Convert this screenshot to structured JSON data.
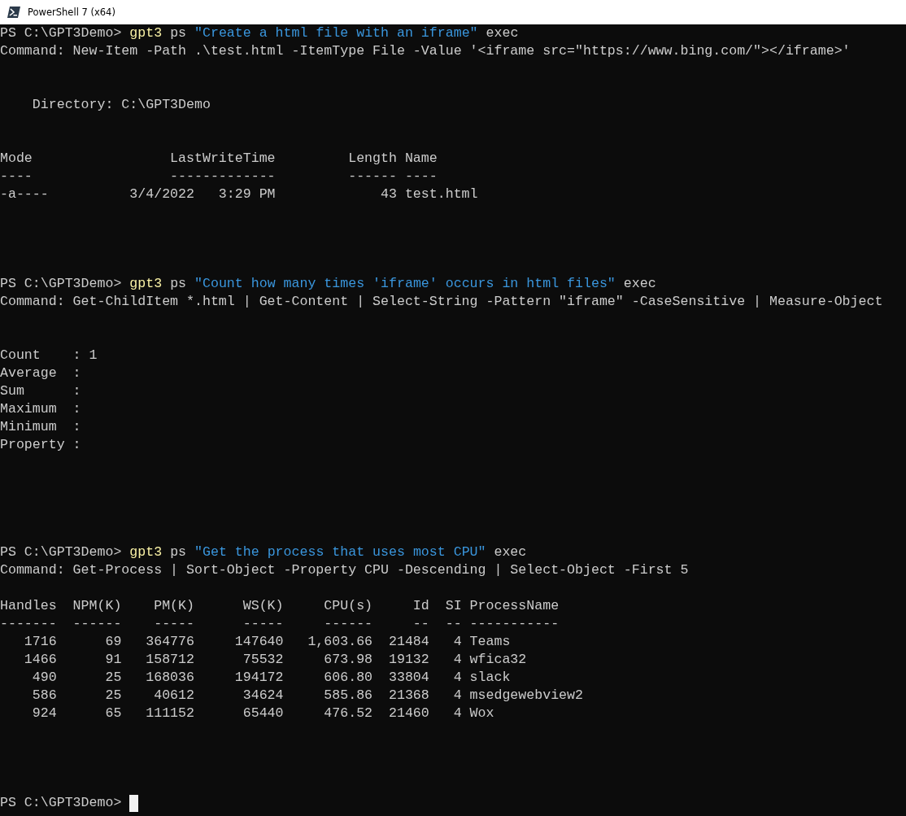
{
  "window": {
    "title": "PowerShell 7 (x64)"
  },
  "terminal": {
    "lines": [
      {
        "kind": "text",
        "segments": [
          {
            "kind": "plain",
            "text": "PS C:\\GPT3Demo> "
          },
          {
            "kind": "command",
            "text": "gpt3"
          },
          {
            "kind": "plain",
            "text": " ps "
          },
          {
            "kind": "string",
            "text": "\"Create a html file with an iframe\""
          },
          {
            "kind": "plain",
            "text": " exec"
          }
        ]
      },
      {
        "kind": "text",
        "segments": [
          {
            "kind": "plain",
            "text": "Command: New-Item -Path .\\test.html -ItemType File -Value '<iframe src=\"https://www.bing.com/\"></iframe>'"
          }
        ]
      },
      {
        "kind": "blank"
      },
      {
        "kind": "blank"
      },
      {
        "kind": "text",
        "segments": [
          {
            "kind": "plain",
            "text": "    Directory: C:\\GPT3Demo"
          }
        ]
      },
      {
        "kind": "blank"
      },
      {
        "kind": "blank"
      },
      {
        "kind": "text",
        "segments": [
          {
            "kind": "plain",
            "text": "Mode                 LastWriteTime         Length Name"
          }
        ]
      },
      {
        "kind": "text",
        "segments": [
          {
            "kind": "plain",
            "text": "----                 -------------         ------ ----"
          }
        ]
      },
      {
        "kind": "text",
        "segments": [
          {
            "kind": "plain",
            "text": "-a----          3/4/2022   3:29 PM             43 test.html"
          }
        ]
      },
      {
        "kind": "blank"
      },
      {
        "kind": "blank"
      },
      {
        "kind": "blank"
      },
      {
        "kind": "blank"
      },
      {
        "kind": "text",
        "segments": [
          {
            "kind": "plain",
            "text": "PS C:\\GPT3Demo> "
          },
          {
            "kind": "command",
            "text": "gpt3"
          },
          {
            "kind": "plain",
            "text": " ps "
          },
          {
            "kind": "string",
            "text": "\"Count how many times 'iframe' occurs in html files\""
          },
          {
            "kind": "plain",
            "text": " exec"
          }
        ]
      },
      {
        "kind": "text",
        "segments": [
          {
            "kind": "plain",
            "text": "Command: Get-ChildItem *.html | Get-Content | Select-String -Pattern \"iframe\" -CaseSensitive | Measure-Object"
          }
        ]
      },
      {
        "kind": "blank"
      },
      {
        "kind": "blank"
      },
      {
        "kind": "text",
        "segments": [
          {
            "kind": "plain",
            "text": "Count    : 1"
          }
        ]
      },
      {
        "kind": "text",
        "segments": [
          {
            "kind": "plain",
            "text": "Average  :"
          }
        ]
      },
      {
        "kind": "text",
        "segments": [
          {
            "kind": "plain",
            "text": "Sum      :"
          }
        ]
      },
      {
        "kind": "text",
        "segments": [
          {
            "kind": "plain",
            "text": "Maximum  :"
          }
        ]
      },
      {
        "kind": "text",
        "segments": [
          {
            "kind": "plain",
            "text": "Minimum  :"
          }
        ]
      },
      {
        "kind": "text",
        "segments": [
          {
            "kind": "plain",
            "text": "Property :"
          }
        ]
      },
      {
        "kind": "blank"
      },
      {
        "kind": "blank"
      },
      {
        "kind": "blank"
      },
      {
        "kind": "blank"
      },
      {
        "kind": "blank"
      },
      {
        "kind": "text",
        "segments": [
          {
            "kind": "plain",
            "text": "PS C:\\GPT3Demo> "
          },
          {
            "kind": "command",
            "text": "gpt3"
          },
          {
            "kind": "plain",
            "text": " ps "
          },
          {
            "kind": "string",
            "text": "\"Get the process that uses most CPU\""
          },
          {
            "kind": "plain",
            "text": " exec"
          }
        ]
      },
      {
        "kind": "text",
        "segments": [
          {
            "kind": "plain",
            "text": "Command: Get-Process | Sort-Object -Property CPU -Descending | Select-Object -First 5"
          }
        ]
      },
      {
        "kind": "blank"
      },
      {
        "kind": "text",
        "segments": [
          {
            "kind": "plain",
            "text": "Handles  NPM(K)    PM(K)      WS(K)     CPU(s)     Id  SI ProcessName"
          }
        ]
      },
      {
        "kind": "text",
        "segments": [
          {
            "kind": "plain",
            "text": "-------  ------    -----      -----     ------     --  -- -----------"
          }
        ]
      },
      {
        "kind": "text",
        "segments": [
          {
            "kind": "plain",
            "text": "   1716      69   364776     147640   1,603.66  21484   4 Teams"
          }
        ]
      },
      {
        "kind": "text",
        "segments": [
          {
            "kind": "plain",
            "text": "   1466      91   158712      75532     673.98  19132   4 wfica32"
          }
        ]
      },
      {
        "kind": "text",
        "segments": [
          {
            "kind": "plain",
            "text": "    490      25   168036     194172     606.80  33804   4 slack"
          }
        ]
      },
      {
        "kind": "text",
        "segments": [
          {
            "kind": "plain",
            "text": "    586      25    40612      34624     585.86  21368   4 msedgewebview2"
          }
        ]
      },
      {
        "kind": "text",
        "segments": [
          {
            "kind": "plain",
            "text": "    924      65   111152      65440     476.52  21460   4 Wox"
          }
        ]
      },
      {
        "kind": "blank"
      },
      {
        "kind": "blank"
      },
      {
        "kind": "blank"
      },
      {
        "kind": "blank"
      },
      {
        "kind": "text",
        "cursor": true,
        "segments": [
          {
            "kind": "plain",
            "text": "PS C:\\GPT3Demo> "
          }
        ]
      }
    ]
  }
}
